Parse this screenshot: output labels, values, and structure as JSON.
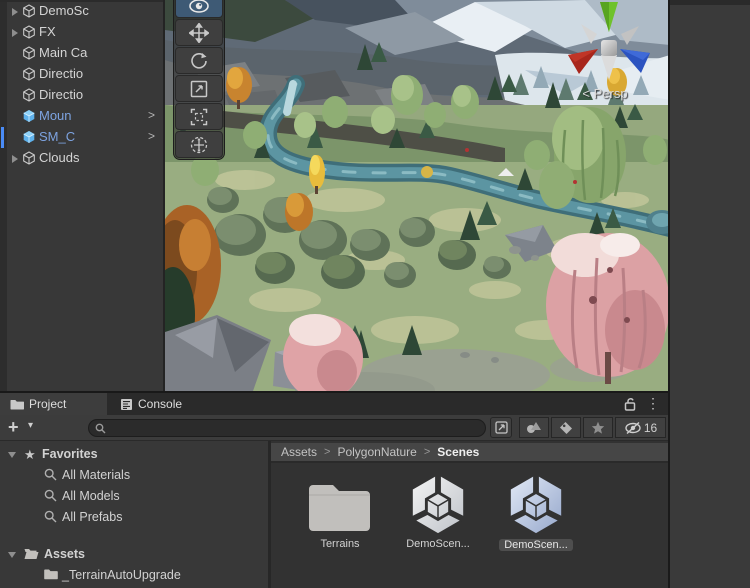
{
  "hierarchy": {
    "items": [
      {
        "label": "DemoSc",
        "kind": "gameobject",
        "expandable": true
      },
      {
        "label": "FX",
        "kind": "gameobject",
        "expandable": true
      },
      {
        "label": "Main Ca",
        "kind": "gameobject",
        "expandable": false
      },
      {
        "label": "Directio",
        "kind": "gameobject",
        "expandable": false
      },
      {
        "label": "Directio",
        "kind": "gameobject",
        "expandable": false
      },
      {
        "label": "Moun",
        "kind": "prefab",
        "expandable": false
      },
      {
        "label": "SM_C",
        "kind": "prefab",
        "expandable": false,
        "selected": true
      },
      {
        "label": "Clouds",
        "kind": "gameobject",
        "expandable": true
      }
    ]
  },
  "scene_view": {
    "orientation_chevron": "<",
    "orientation_label": "Persp",
    "tools": [
      "view",
      "move",
      "rotate",
      "scale",
      "rect",
      "transform"
    ],
    "active_tool": "view"
  },
  "project_panel": {
    "tabs": [
      {
        "label": "Project",
        "active": true
      },
      {
        "label": "Console",
        "active": false
      }
    ],
    "create_plus": "+",
    "create_caret": "▾",
    "menu_dots": "⋮",
    "search_value": "",
    "hidden_count": "16",
    "favorites": {
      "header": "Favorites",
      "items": [
        {
          "label": "All Materials"
        },
        {
          "label": "All Models"
        },
        {
          "label": "All Prefabs"
        }
      ]
    },
    "assets": {
      "header": "Assets",
      "items": [
        {
          "label": "_TerrainAutoUpgrade"
        }
      ]
    },
    "breadcrumb": {
      "separator": ">",
      "parts": [
        {
          "label": "Assets"
        },
        {
          "label": "PolygonNature"
        },
        {
          "label": "Scenes"
        }
      ]
    },
    "grid": [
      {
        "label": "Terrains",
        "type": "folder"
      },
      {
        "label": "DemoScen...",
        "type": "unity-scene"
      },
      {
        "label": "DemoScen...",
        "type": "unity-scene",
        "selected": true
      }
    ]
  },
  "icons": {
    "enter_arrow": ">",
    "star": "★"
  },
  "colors": {
    "prefab_text": "#7da3e0",
    "prefab_icon": "#5fb2ec",
    "selection_bar": "#4a8cf7",
    "tool_active_bg": "#3e5a75",
    "gizmo_green": "#6fc22b",
    "gizmo_red": "#a8261c",
    "gizmo_blue": "#2b53c0",
    "river": "#5c95a2",
    "pink_tree": "#dca1a4"
  }
}
